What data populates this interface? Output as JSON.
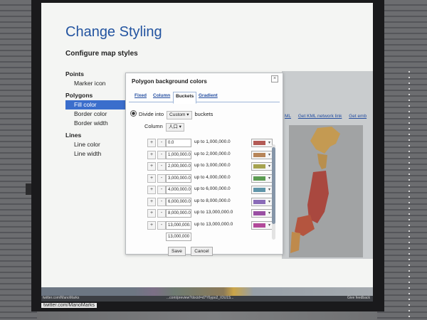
{
  "slide": {
    "title": "Change Styling",
    "subtitle": "Configure map styles"
  },
  "sidebar": {
    "groups": [
      {
        "label": "Points",
        "items": [
          "Marker icon"
        ]
      },
      {
        "label": "Polygons",
        "items": [
          "Fill color",
          "Border color",
          "Border width"
        ]
      },
      {
        "label": "Lines",
        "items": [
          "Line color",
          "Line width"
        ]
      }
    ],
    "active_item": "Fill color"
  },
  "map_panel": {
    "links": [
      "ML",
      "Get KML network link",
      "Get emb"
    ]
  },
  "dialog": {
    "title": "Polygon background colors",
    "close_glyph": "×",
    "tabs": [
      "Fixed",
      "Column",
      "Buckets",
      "Gradient"
    ],
    "active_tab": "Buckets",
    "mode_prefix": "Divide into",
    "mode_select": "Custom",
    "mode_suffix": "buckets",
    "column_label": "Column",
    "column_select": "人口",
    "up_to_prefix": "up to",
    "buckets": [
      {
        "from": "0.0",
        "to": "1,000,000.0",
        "color": "#b35a55"
      },
      {
        "from": "1,000,000.0",
        "to": "2,000,000.0",
        "color": "#b78559"
      },
      {
        "from": "2,000,000.0",
        "to": "3,000,000.0",
        "color": "#a6a350"
      },
      {
        "from": "3,000,000.0",
        "to": "4,000,000.0",
        "color": "#5c9c52"
      },
      {
        "from": "4,000,000.0",
        "to": "6,000,000.0",
        "color": "#5f95a9"
      },
      {
        "from": "6,000,000.0",
        "to": "8,000,000.0",
        "color": "#8a6bb8"
      },
      {
        "from": "8,000,000.0",
        "to": "13,000,000.0",
        "color": "#9a4fa3"
      },
      {
        "from": "13,000,000.0",
        "to": "13,000,000.0",
        "color": "#b24a9a"
      }
    ],
    "last_field": "13,000,000",
    "plus_glyph": "+",
    "minus_glyph": "-",
    "dropdown_glyph": "▾"
  },
  "actions": {
    "save": "Save",
    "cancel": "Cancel"
  },
  "statusbar": {
    "left": "twitter.com/ManoMarks",
    "url": "...com/preview?docid=d7Y6ypo2_IOU1S...",
    "right": "Give feedback"
  },
  "watermark": "twitter.com/ManoMarks"
}
